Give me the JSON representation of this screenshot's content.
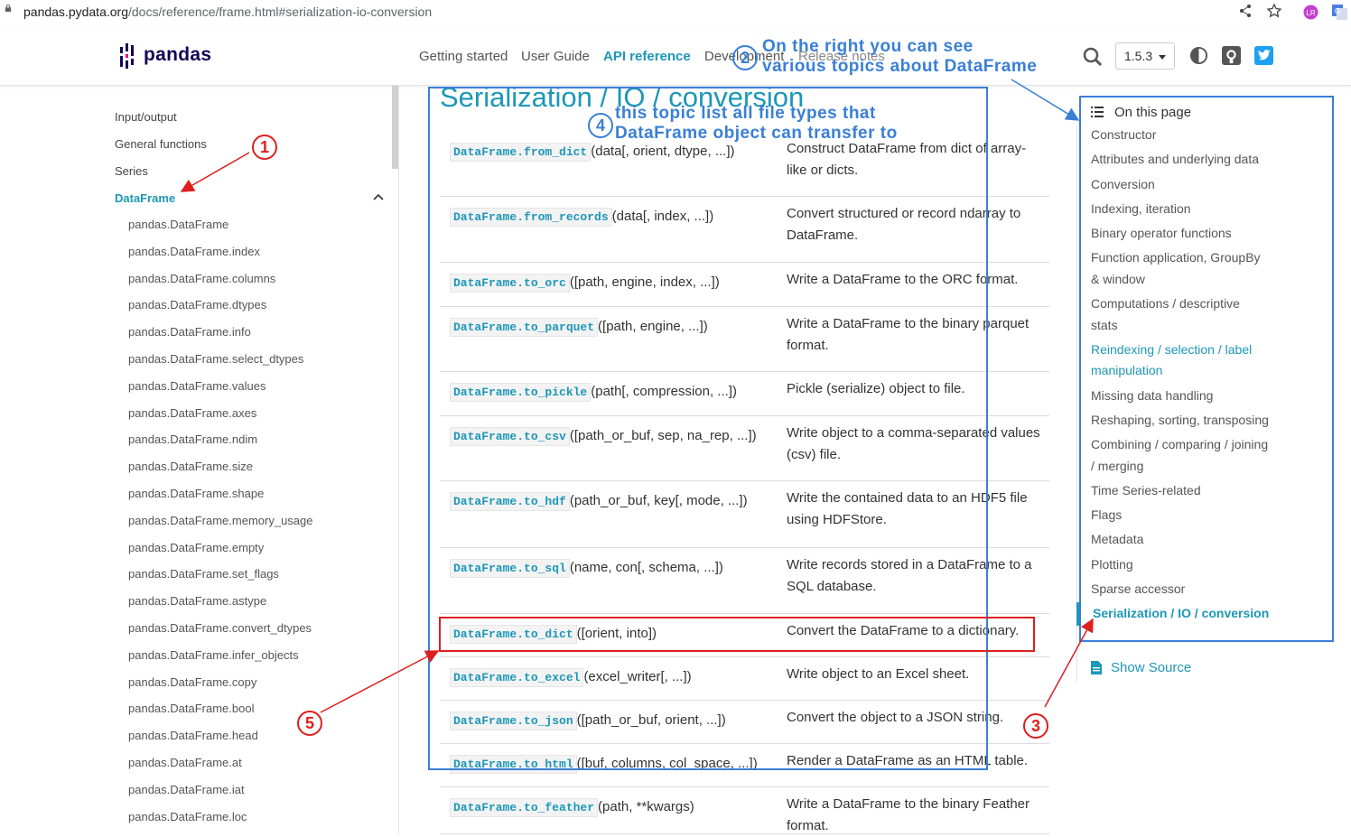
{
  "browser": {
    "url_host": "pandas.pydata.org",
    "url_path": "/docs/reference/frame.html#serialization-io-conversion"
  },
  "header": {
    "logo_text": "pandas",
    "nav": [
      "Getting started",
      "User Guide",
      "API reference",
      "Development",
      "Release notes"
    ],
    "version": "1.5.3"
  },
  "sidebar": {
    "sections": [
      "Input/output",
      "General functions",
      "Series",
      "DataFrame"
    ],
    "items": [
      "pandas.DataFrame",
      "pandas.DataFrame.index",
      "pandas.DataFrame.columns",
      "pandas.DataFrame.dtypes",
      "pandas.DataFrame.info",
      "pandas.DataFrame.select_dtypes",
      "pandas.DataFrame.values",
      "pandas.DataFrame.axes",
      "pandas.DataFrame.ndim",
      "pandas.DataFrame.size",
      "pandas.DataFrame.shape",
      "pandas.DataFrame.memory_usage",
      "pandas.DataFrame.empty",
      "pandas.DataFrame.set_flags",
      "pandas.DataFrame.astype",
      "pandas.DataFrame.convert_dtypes",
      "pandas.DataFrame.infer_objects",
      "pandas.DataFrame.copy",
      "pandas.DataFrame.bool",
      "pandas.DataFrame.head",
      "pandas.DataFrame.at",
      "pandas.DataFrame.iat",
      "pandas.DataFrame.loc"
    ]
  },
  "main": {
    "title": "Serialization / IO / conversion",
    "rows": [
      {
        "code": "DataFrame.from_dict",
        "args": "(data[, orient, dtype, ...])",
        "desc": "Construct DataFrame from dict of array-like or dicts."
      },
      {
        "code": "DataFrame.from_records",
        "args": "(data[, index, ...])",
        "desc": "Convert structured or record ndarray to DataFrame."
      },
      {
        "code": "DataFrame.to_orc",
        "args": "([path, engine, index, ...])",
        "desc": "Write a DataFrame to the ORC format."
      },
      {
        "code": "DataFrame.to_parquet",
        "args": "([path, engine, ...])",
        "desc": "Write a DataFrame to the binary parquet format."
      },
      {
        "code": "DataFrame.to_pickle",
        "args": "(path[, compression, ...])",
        "desc": "Pickle (serialize) object to file."
      },
      {
        "code": "DataFrame.to_csv",
        "args": "([path_or_buf, sep, na_rep, ...])",
        "desc": "Write object to a comma-separated values (csv) file."
      },
      {
        "code": "DataFrame.to_hdf",
        "args": "(path_or_buf, key[, mode, ...])",
        "desc": "Write the contained data to an HDF5 file using HDFStore."
      },
      {
        "code": "DataFrame.to_sql",
        "args": "(name, con[, schema, ...])",
        "desc": "Write records stored in a DataFrame to a SQL database."
      },
      {
        "code": "DataFrame.to_dict",
        "args": "([orient, into])",
        "desc": "Convert the DataFrame to a dictionary."
      },
      {
        "code": "DataFrame.to_excel",
        "args": "(excel_writer[, ...])",
        "desc": "Write object to an Excel sheet."
      },
      {
        "code": "DataFrame.to_json",
        "args": "([path_or_buf, orient, ...])",
        "desc": "Convert the object to a JSON string."
      },
      {
        "code": "DataFrame.to_html",
        "args": "([buf, columns, col_space, ...])",
        "desc": "Render a DataFrame as an HTML table."
      },
      {
        "code": "DataFrame.to_feather",
        "args": "(path, **kwargs)",
        "desc": "Write a DataFrame to the binary Feather format."
      }
    ]
  },
  "toc": {
    "heading": "On this page",
    "items": [
      "Constructor",
      "Attributes and underlying data",
      "Conversion",
      "Indexing, iteration",
      "Binary operator functions",
      "Function application, GroupBy",
      "& window",
      "Computations / descriptive",
      "stats",
      "Reindexing / selection / label",
      "manipulation",
      "Missing data handling",
      "Reshaping, sorting, transposing",
      "Combining / comparing / joining",
      "/ merging",
      "Time Series-related",
      "Flags",
      "Metadata",
      "Plotting",
      "Sparse accessor",
      "Serialization / IO / conversion"
    ],
    "show_source": "Show Source"
  },
  "annotations": {
    "note2_line1": "On the right you can see",
    "note2_line2": "various topics about DataFrame",
    "note4_line1": "this topic list all file types that",
    "note4_line2": "DataFrame object can transfer to",
    "marker1": "1",
    "marker2": "2",
    "marker3": "3",
    "marker4": "4",
    "marker5": "5"
  },
  "colors": {
    "accent": "#1c97b9",
    "annotation_blue": "#3a7fd6",
    "annotation_red": "#dd1f1f"
  }
}
